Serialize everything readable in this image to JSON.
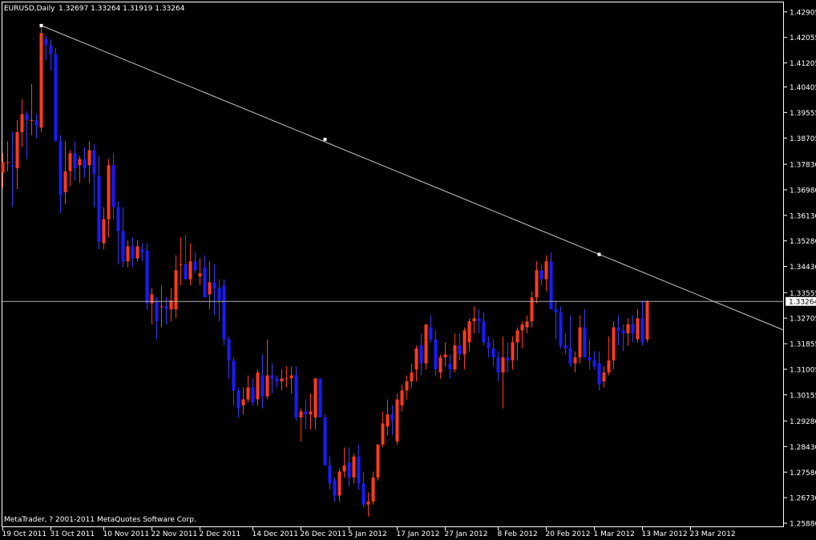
{
  "header": {
    "symbol_timeframe": "EURUSD,Daily",
    "ohlc_text": "1.32697 1.33264 1.31919 1.33264"
  },
  "copyright": "MetaTrader, ? 2001-2011 MetaQuotes Software Corp.",
  "current_price_label": "1.33264",
  "colors": {
    "background": "#000000",
    "bull_candle": "#FF3A1E",
    "bear_candle": "#1A1AFF",
    "wick_up": "#FF3A1E",
    "wick_down": "#3A3AFF",
    "trendline": "#C8C8C8",
    "axis": "#FFFFFF"
  },
  "chart_data": {
    "type": "candlestick",
    "symbol": "EURUSD",
    "timeframe": "Daily",
    "ylim": [
      1.2588,
      1.429
    ],
    "y_ticks": [
      "1.42905",
      "1.42055",
      "1.41205",
      "1.40405",
      "1.39555",
      "1.38705",
      "1.37830",
      "1.36980",
      "1.36130",
      "1.35280",
      "1.34430",
      "1.33555",
      "1.32705",
      "1.31855",
      "1.31005",
      "1.30155",
      "1.29280",
      "1.28430",
      "1.27580",
      "1.26730",
      "1.25880"
    ],
    "x_labels": [
      {
        "index": 0,
        "label": "19 Oct 2011"
      },
      {
        "index": 10,
        "label": "31 Oct 2011"
      },
      {
        "index": 21,
        "label": "10 Nov 2011"
      },
      {
        "index": 31,
        "label": "22 Nov 2011"
      },
      {
        "index": 41,
        "label": "2 Dec 2011"
      },
      {
        "index": 52,
        "label": "14 Dec 2011"
      },
      {
        "index": 62,
        "label": "26 Dec 2011"
      },
      {
        "index": 72,
        "label": "5 Jan 2012"
      },
      {
        "index": 82,
        "label": "17 Jan 2012"
      },
      {
        "index": 92,
        "label": "27 Jan 2012"
      },
      {
        "index": 103,
        "label": "8 Feb 2012"
      },
      {
        "index": 113,
        "label": "20 Feb 2012"
      },
      {
        "index": 123,
        "label": "1 Mar 2012"
      },
      {
        "index": 133,
        "label": "13 Mar 2012"
      },
      {
        "index": 143,
        "label": "23 Mar 2012"
      }
    ],
    "candles": [
      [
        1.3755,
        1.382,
        1.3705,
        1.379
      ],
      [
        1.379,
        1.386,
        1.376,
        1.379
      ],
      [
        1.378,
        1.389,
        1.364,
        1.3775
      ],
      [
        1.377,
        1.393,
        1.37,
        1.389
      ],
      [
        1.389,
        1.4,
        1.384,
        1.395
      ],
      [
        1.395,
        1.396,
        1.38,
        1.393
      ],
      [
        1.393,
        1.405,
        1.388,
        1.393
      ],
      [
        1.393,
        1.395,
        1.387,
        1.391
      ],
      [
        1.3905,
        1.4245,
        1.389,
        1.422
      ],
      [
        1.42,
        1.421,
        1.413,
        1.418
      ],
      [
        1.418,
        1.42,
        1.4095,
        1.415
      ],
      [
        1.415,
        1.417,
        1.386,
        1.386
      ],
      [
        1.386,
        1.388,
        1.362,
        1.368
      ],
      [
        1.369,
        1.386,
        1.365,
        1.376
      ],
      [
        1.376,
        1.383,
        1.371,
        1.382
      ],
      [
        1.382,
        1.386,
        1.373,
        1.377
      ],
      [
        1.378,
        1.381,
        1.372,
        1.38
      ],
      [
        1.38,
        1.384,
        1.374,
        1.377
      ],
      [
        1.378,
        1.386,
        1.372,
        1.383
      ],
      [
        1.383,
        1.385,
        1.364,
        1.375
      ],
      [
        1.3745,
        1.381,
        1.35,
        1.3525
      ],
      [
        1.352,
        1.364,
        1.35,
        1.36
      ],
      [
        1.36,
        1.38,
        1.354,
        1.378
      ],
      [
        1.378,
        1.382,
        1.36,
        1.364
      ],
      [
        1.364,
        1.366,
        1.345,
        1.356
      ],
      [
        1.356,
        1.364,
        1.344,
        1.346
      ],
      [
        1.346,
        1.353,
        1.344,
        1.351
      ],
      [
        1.351,
        1.354,
        1.344,
        1.347
      ],
      [
        1.347,
        1.353,
        1.346,
        1.351
      ],
      [
        1.35,
        1.352,
        1.346,
        1.349
      ],
      [
        1.3495,
        1.352,
        1.33,
        1.332
      ],
      [
        1.332,
        1.337,
        1.325,
        1.335
      ],
      [
        1.333,
        1.334,
        1.32,
        1.326
      ],
      [
        1.331,
        1.338,
        1.324,
        1.331
      ],
      [
        1.331,
        1.334,
        1.325,
        1.33
      ],
      [
        1.33,
        1.337,
        1.326,
        1.333
      ],
      [
        1.33,
        1.348,
        1.327,
        1.343
      ],
      [
        1.345,
        1.354,
        1.338,
        1.345
      ],
      [
        1.345,
        1.355,
        1.34,
        1.34
      ],
      [
        1.34,
        1.352,
        1.338,
        1.346
      ],
      [
        1.346,
        1.349,
        1.342,
        1.343
      ],
      [
        1.341,
        1.347,
        1.338,
        1.342
      ],
      [
        1.344,
        1.348,
        1.337,
        1.334
      ],
      [
        1.335,
        1.346,
        1.33,
        1.339
      ],
      [
        1.339,
        1.345,
        1.328,
        1.337
      ],
      [
        1.337,
        1.34,
        1.326,
        1.333
      ],
      [
        1.338,
        1.34,
        1.318,
        1.32
      ],
      [
        1.32,
        1.321,
        1.307,
        1.313
      ],
      [
        1.313,
        1.314,
        1.298,
        1.303
      ],
      [
        1.303,
        1.304,
        1.294,
        1.297
      ],
      [
        1.298,
        1.304,
        1.295,
        1.3
      ],
      [
        1.3,
        1.308,
        1.299,
        1.304
      ],
      [
        1.304,
        1.307,
        1.298,
        1.299
      ],
      [
        1.3,
        1.31,
        1.298,
        1.309
      ],
      [
        1.308,
        1.315,
        1.297,
        1.301
      ],
      [
        1.301,
        1.32,
        1.3,
        1.308
      ],
      [
        1.308,
        1.312,
        1.302,
        1.307
      ],
      [
        1.307,
        1.308,
        1.304,
        1.306
      ],
      [
        1.306,
        1.31,
        1.303,
        1.307
      ],
      [
        1.307,
        1.311,
        1.304,
        1.307
      ],
      [
        1.307,
        1.311,
        1.302,
        1.308
      ],
      [
        1.308,
        1.311,
        1.293,
        1.294
      ],
      [
        1.294,
        1.297,
        1.286,
        1.296
      ],
      [
        1.296,
        1.3,
        1.29,
        1.295
      ],
      [
        1.295,
        1.302,
        1.29,
        1.296
      ],
      [
        1.294,
        1.306,
        1.29,
        1.307
      ],
      [
        1.307,
        1.307,
        1.294,
        1.294
      ],
      [
        1.294,
        1.295,
        1.278,
        1.278
      ],
      [
        1.278,
        1.281,
        1.27,
        1.272
      ],
      [
        1.273,
        1.274,
        1.266,
        1.268
      ],
      [
        1.268,
        1.277,
        1.266,
        1.276
      ],
      [
        1.276,
        1.284,
        1.274,
        1.278
      ],
      [
        1.279,
        1.284,
        1.271,
        1.274
      ],
      [
        1.274,
        1.282,
        1.272,
        1.281
      ],
      [
        1.281,
        1.285,
        1.27,
        1.272
      ],
      [
        1.272,
        1.276,
        1.264,
        1.265
      ],
      [
        1.265,
        1.269,
        1.261,
        1.266
      ],
      [
        1.266,
        1.276,
        1.265,
        1.274
      ],
      [
        1.274,
        1.285,
        1.273,
        1.285
      ],
      [
        1.285,
        1.296,
        1.284,
        1.292
      ],
      [
        1.291,
        1.3,
        1.288,
        1.295
      ],
      [
        1.295,
        1.298,
        1.288,
        1.293
      ],
      [
        1.286,
        1.302,
        1.285,
        1.3
      ],
      [
        1.298,
        1.305,
        1.296,
        1.303
      ],
      [
        1.303,
        1.308,
        1.3,
        1.306
      ],
      [
        1.306,
        1.312,
        1.304,
        1.309
      ],
      [
        1.31,
        1.318,
        1.306,
        1.317
      ],
      [
        1.318,
        1.322,
        1.308,
        1.312
      ],
      [
        1.312,
        1.325,
        1.31,
        1.325
      ],
      [
        1.324,
        1.328,
        1.319,
        1.32
      ],
      [
        1.32,
        1.323,
        1.308,
        1.31
      ],
      [
        1.309,
        1.315,
        1.307,
        1.314
      ],
      [
        1.314,
        1.319,
        1.311,
        1.315
      ],
      [
        1.312,
        1.315,
        1.307,
        1.31
      ],
      [
        1.31,
        1.322,
        1.309,
        1.318
      ],
      [
        1.318,
        1.322,
        1.313,
        1.315
      ],
      [
        1.315,
        1.324,
        1.31,
        1.323
      ],
      [
        1.319,
        1.327,
        1.316,
        1.326
      ],
      [
        1.326,
        1.331,
        1.322,
        1.327
      ],
      [
        1.327,
        1.33,
        1.322,
        1.326
      ],
      [
        1.326,
        1.329,
        1.318,
        1.319
      ],
      [
        1.319,
        1.321,
        1.314,
        1.317
      ],
      [
        1.317,
        1.32,
        1.311,
        1.314
      ],
      [
        1.314,
        1.316,
        1.306,
        1.309
      ],
      [
        1.309,
        1.321,
        1.297,
        1.314
      ],
      [
        1.314,
        1.319,
        1.309,
        1.313
      ],
      [
        1.313,
        1.321,
        1.31,
        1.319
      ],
      [
        1.319,
        1.324,
        1.313,
        1.323
      ],
      [
        1.323,
        1.326,
        1.317,
        1.325
      ],
      [
        1.324,
        1.328,
        1.322,
        1.326
      ],
      [
        1.326,
        1.336,
        1.324,
        1.334
      ],
      [
        1.334,
        1.346,
        1.332,
        1.343
      ],
      [
        1.343,
        1.345,
        1.338,
        1.34
      ],
      [
        1.34,
        1.348,
        1.336,
        1.346
      ],
      [
        1.346,
        1.349,
        1.33,
        1.33
      ],
      [
        1.33,
        1.333,
        1.32,
        1.329
      ],
      [
        1.329,
        1.331,
        1.317,
        1.318
      ],
      [
        1.318,
        1.322,
        1.315,
        1.317
      ],
      [
        1.317,
        1.328,
        1.311,
        1.312
      ],
      [
        1.312,
        1.316,
        1.309,
        1.314
      ],
      [
        1.314,
        1.328,
        1.312,
        1.324
      ],
      [
        1.324,
        1.33,
        1.314,
        1.314
      ],
      [
        1.314,
        1.32,
        1.31,
        1.313
      ],
      [
        1.313,
        1.316,
        1.31,
        1.311
      ],
      [
        1.312,
        1.316,
        1.303,
        1.305
      ],
      [
        1.306,
        1.311,
        1.304,
        1.309
      ],
      [
        1.309,
        1.321,
        1.308,
        1.313
      ],
      [
        1.313,
        1.326,
        1.31,
        1.324
      ],
      [
        1.324,
        1.328,
        1.318,
        1.323
      ],
      [
        1.323,
        1.325,
        1.316,
        1.322
      ],
      [
        1.322,
        1.327,
        1.318,
        1.325
      ],
      [
        1.325,
        1.328,
        1.319,
        1.322
      ],
      [
        1.32,
        1.33,
        1.319,
        1.327
      ],
      [
        1.327,
        1.333,
        1.318,
        1.319
      ],
      [
        1.32,
        1.333,
        1.319,
        1.3326
      ]
    ],
    "trendline": {
      "color": "#C8C8C8",
      "points": [
        {
          "index": 8,
          "price": 1.4245
        },
        {
          "index": 67,
          "price": 1.3866
        },
        {
          "index": 124,
          "price": 1.3483
        }
      ]
    },
    "current_price": 1.33264,
    "grid": false
  }
}
